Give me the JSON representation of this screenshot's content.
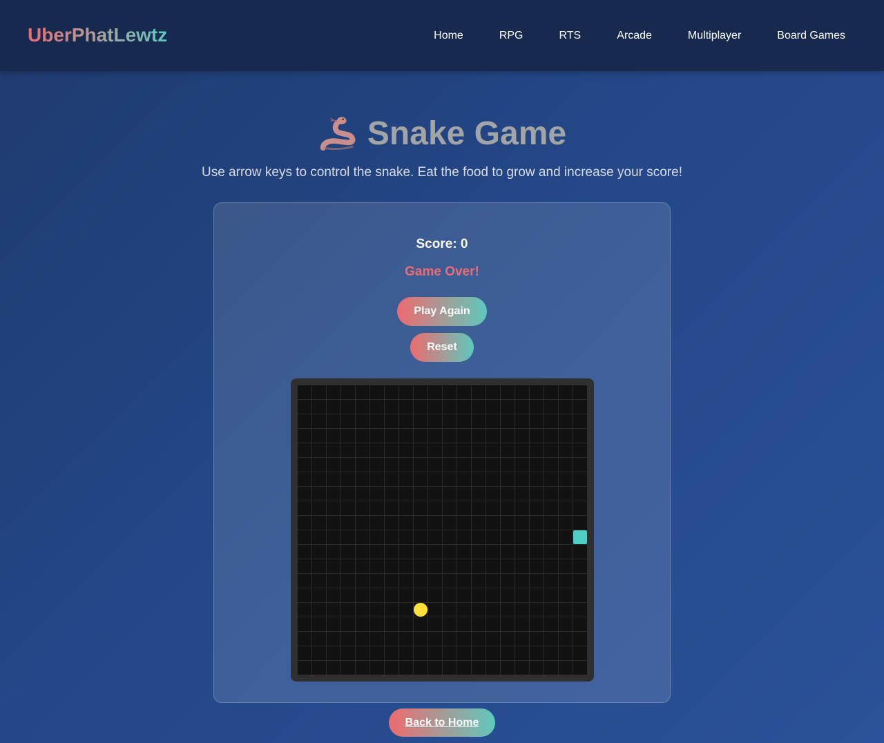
{
  "header": {
    "logo": "UberPhatLewtz",
    "nav": [
      {
        "label": "Home"
      },
      {
        "label": "RPG"
      },
      {
        "label": "RTS"
      },
      {
        "label": "Arcade"
      },
      {
        "label": "Multiplayer"
      },
      {
        "label": "Board Games"
      }
    ]
  },
  "hero": {
    "icon": "snake-icon",
    "title": "Snake Game",
    "subtitle": "Use arrow keys to control the snake. Eat the food to grow and increase your score!"
  },
  "game": {
    "score_label": "Score: 0",
    "status": "Game Over!",
    "play_again_label": "Play Again",
    "reset_label": "Reset",
    "grid": {
      "cols": 20,
      "rows": 20
    },
    "snake": [
      {
        "col": 19,
        "row": 10
      }
    ],
    "food": {
      "col": 8,
      "row": 15
    },
    "colors": {
      "snake": "#4ecdc4",
      "food": "#ffe13a",
      "cell": "#111111",
      "accent_start": "#ee6b6e",
      "accent_end": "#5ec9be"
    }
  },
  "footer": {
    "back_label": "Back to Home"
  }
}
